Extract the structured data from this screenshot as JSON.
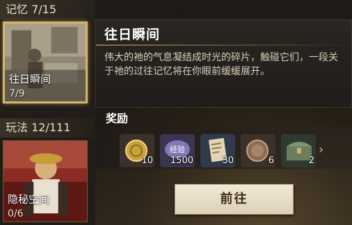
{
  "categories": [
    {
      "label": "记忆 7/15"
    },
    {
      "label": "玩法 12/111"
    }
  ],
  "cards": [
    {
      "title": "往日瞬间",
      "count": "7/9"
    },
    {
      "title": "隐秘空间",
      "count": "0/6"
    }
  ],
  "popup": {
    "title": "往日瞬间",
    "description": "伟大的祂的气息凝结成时光的碎片，触碰它们，一段关于祂的过往记忆将在你眼前缓缓展开。"
  },
  "rewards": {
    "label": "奖励",
    "items": [
      {
        "icon": "gold-coin-icon",
        "qty": "10"
      },
      {
        "icon": "experience-icon",
        "icon_text": "经验",
        "qty": "1500"
      },
      {
        "icon": "document-icon",
        "qty": "30"
      },
      {
        "icon": "medal-coin-icon",
        "qty": "6"
      },
      {
        "icon": "treasure-chest-icon",
        "qty": "2"
      }
    ]
  },
  "go_button": {
    "label": "前往"
  },
  "colors": {
    "accent": "#d8b46a",
    "button": "#eee5d0",
    "text": "#d9ceba"
  }
}
